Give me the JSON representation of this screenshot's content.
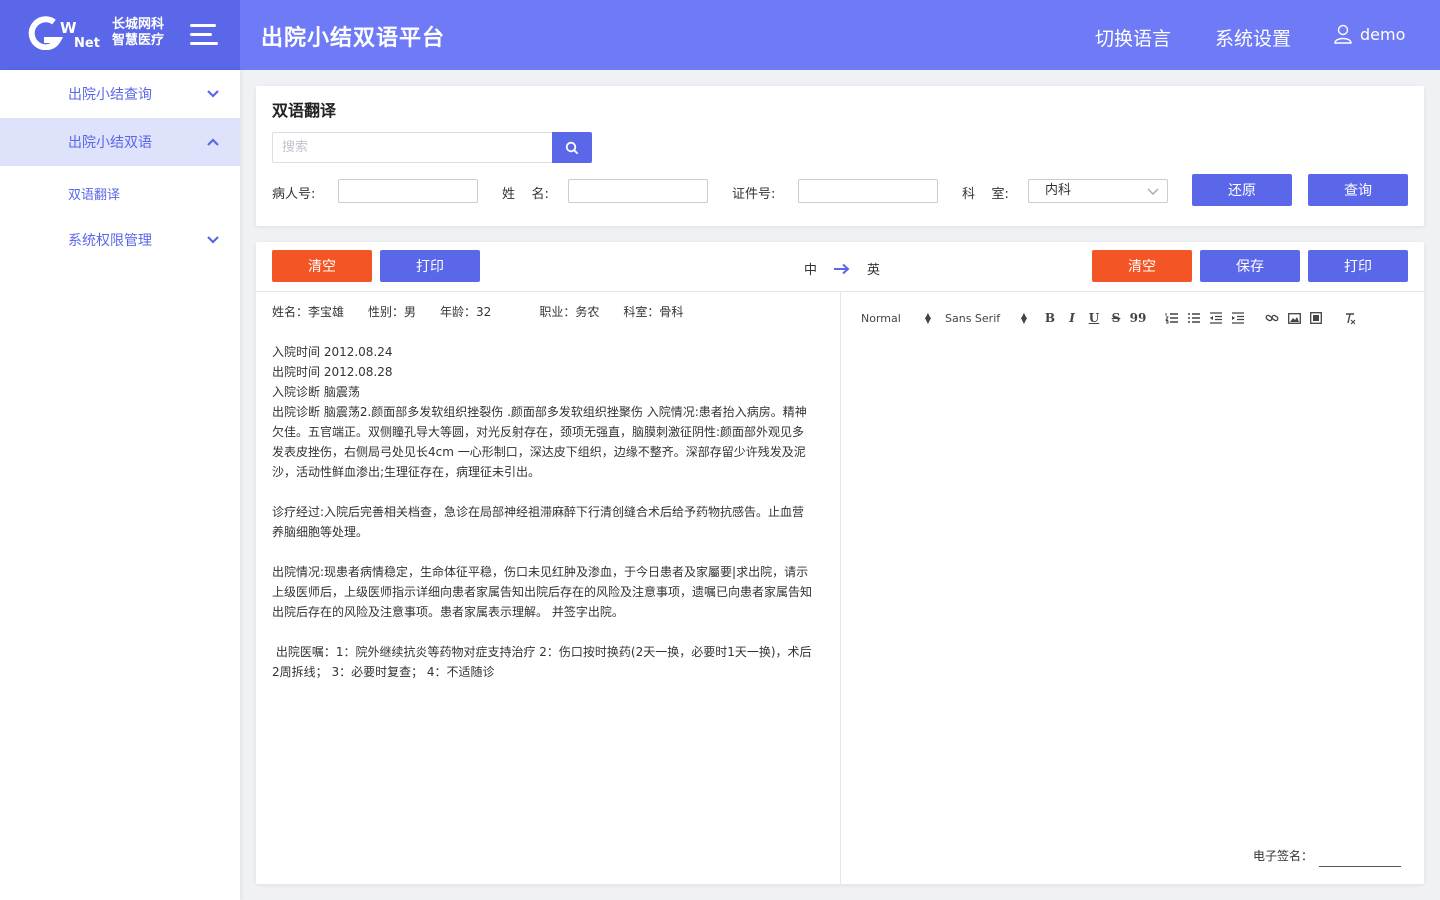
{
  "header": {
    "logo_line1": "长城网科",
    "logo_line2": "智慧医疗",
    "logo_mark_text": "GW Net",
    "title": "出院小结双语平台",
    "switch_language": "切换语言",
    "system_settings": "系统设置",
    "username": "demo"
  },
  "sidebar": {
    "items": [
      {
        "label": "出院小结查询",
        "expanded": false
      },
      {
        "label": "出院小结双语",
        "expanded": true
      },
      {
        "label": "双语翻译"
      },
      {
        "label": "系统权限管理",
        "expanded": false
      }
    ]
  },
  "search_panel": {
    "title": "双语翻译",
    "search_placeholder": "搜索",
    "search_value": "",
    "patient_no_label": "病人号:",
    "patient_no_value": "",
    "name_label": "姓    名:",
    "name_value": "",
    "id_no_label": "证件号:",
    "id_no_value": "",
    "dept_label": "科    室:",
    "dept_value": "内科",
    "reset_button": "还原",
    "query_button": "查询"
  },
  "editor": {
    "left_clear": "清空",
    "left_print": "打印",
    "lang_from": "中",
    "lang_to": "英",
    "right_clear": "清空",
    "right_save": "保存",
    "right_print": "打印",
    "patient_info": {
      "name": "姓名：李宝雄",
      "gender": "性别：男",
      "age": "年龄：32",
      "job": "职业：务农",
      "dept": "科室：骨科"
    },
    "paragraphs": [
      "入院时间 2012.08.24\n出院时间 2012.08.28\n入院诊断 脑震荡\n出院诊断 脑震荡2.颜面部多发软组织挫裂伤 .颜面部多发软组织挫聚伤 入院情况:患者抬入病房。精神欠佳。五官端正。双侧瞳孔导大等圆，对光反射存在，颈项无强直，脑膜刺激征阴性:颜面部外观见多发表皮挫伤，右侧局弓处见长4cm 一心形制口，深达皮下组织，边缘不整齐。深部存留少许残发及泥沙，活动性鲜血渗出;生理征存在，病理征未引出。",
      "诊疗经过:入院后完善相关档查，急诊在局部神经祖滞麻醉下行清创缝合术后给予药物抗感告。止血营养脑细胞等处理。",
      "出院情况:现患者病情稳定，生命体征平稳，伤口未见红肿及渗血，于今日患者及家屬要|求出院，请示上级医师后，上级医师指示详细向患者家属告知出院后存在的风险及注意事项，遗嘱已向患者家属告知出院后存在的风险及注意事项。患者家属表示理解。 并签字出院。",
      " 出院医嘱：1：院外继续抗炎等药物对症支持治疗 2：伤口按时换药(2天一换，必要时1天一换)，术后2周拆线； 3：必要时复查； 4：不适随诊"
    ],
    "toolbar": {
      "size_select": "Normal",
      "font_select": "Sans Serif",
      "buttons": [
        "B",
        "I",
        "U",
        "S",
        "99"
      ]
    },
    "signature_label": "电子签名："
  },
  "colors": {
    "primary": "#5a67e8",
    "header": "#6f7af6",
    "danger": "#f35624"
  }
}
